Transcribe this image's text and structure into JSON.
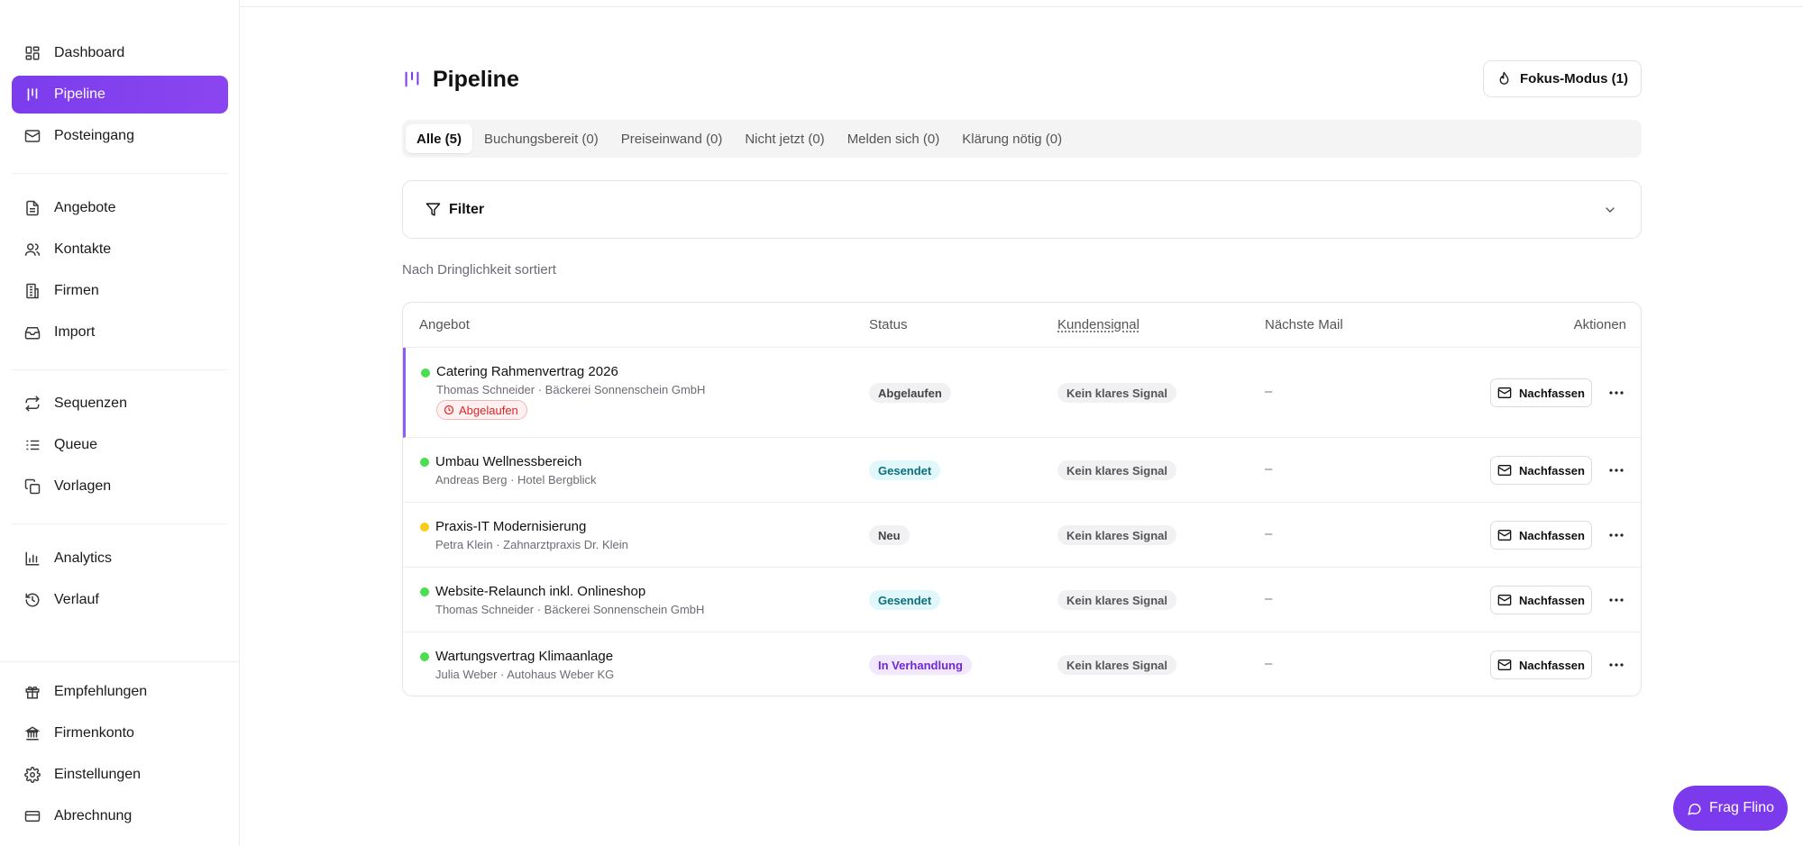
{
  "colors": {
    "accent": "#7c3aed",
    "status_green": "#4ade50",
    "status_yellow": "#facc15",
    "warning": "#dc2626"
  },
  "sidebar": {
    "groups": [
      [
        {
          "label": "Dashboard",
          "icon": "dashboard-icon"
        },
        {
          "label": "Pipeline",
          "icon": "pipeline-icon",
          "active": true
        },
        {
          "label": "Posteingang",
          "icon": "mail-icon"
        }
      ],
      [
        {
          "label": "Angebote",
          "icon": "document-icon"
        },
        {
          "label": "Kontakte",
          "icon": "users-icon"
        },
        {
          "label": "Firmen",
          "icon": "building-icon"
        },
        {
          "label": "Import",
          "icon": "inbox-icon"
        }
      ],
      [
        {
          "label": "Sequenzen",
          "icon": "repeat-icon"
        },
        {
          "label": "Queue",
          "icon": "list-icon"
        },
        {
          "label": "Vorlagen",
          "icon": "copy-icon"
        }
      ],
      [
        {
          "label": "Analytics",
          "icon": "chart-icon"
        },
        {
          "label": "Verlauf",
          "icon": "history-icon"
        }
      ],
      [
        {
          "label": "Empfehlungen",
          "icon": "gift-icon"
        },
        {
          "label": "Firmenkonto",
          "icon": "bank-icon"
        },
        {
          "label": "Einstellungen",
          "icon": "gear-icon"
        },
        {
          "label": "Abrechnung",
          "icon": "credit-card-icon"
        }
      ]
    ]
  },
  "header": {
    "title": "Pipeline",
    "fokus_label": "Fokus-Modus (1)"
  },
  "tabs": [
    {
      "label": "Alle (5)",
      "active": true
    },
    {
      "label": "Buchungsbereit (0)"
    },
    {
      "label": "Preiseinwand (0)"
    },
    {
      "label": "Nicht jetzt (0)"
    },
    {
      "label": "Melden sich (0)"
    },
    {
      "label": "Klärung nötig (0)"
    }
  ],
  "filter": {
    "label": "Filter"
  },
  "sort_note": "Nach Dringlichkeit sortiert",
  "table": {
    "columns": {
      "angebot": "Angebot",
      "status": "Status",
      "signal": "Kundensignal",
      "next_mail": "Nächste Mail",
      "actions": "Aktionen"
    },
    "action_label": "Nachfassen",
    "rows": [
      {
        "title": "Catering Rahmenvertrag 2026",
        "subtitle": "Thomas Schneider · Bäckerei Sonnenschein GmbH",
        "dot": "green",
        "warning": "Abgelaufen",
        "status": "Abgelaufen",
        "status_style": "gray",
        "signal": "Kein klares Signal",
        "next_mail": "–"
      },
      {
        "title": "Umbau Wellnessbereich",
        "subtitle": "Andreas Berg · Hotel Bergblick",
        "dot": "green",
        "status": "Gesendet",
        "status_style": "cyan",
        "signal": "Kein klares Signal",
        "next_mail": "–"
      },
      {
        "title": "Praxis-IT Modernisierung",
        "subtitle": "Petra Klein · Zahnarztpraxis Dr. Klein",
        "dot": "yellow",
        "status": "Neu",
        "status_style": "gray",
        "signal": "Kein klares Signal",
        "next_mail": "–"
      },
      {
        "title": "Website-Relaunch inkl. Onlineshop",
        "subtitle": "Thomas Schneider · Bäckerei Sonnenschein GmbH",
        "dot": "green",
        "status": "Gesendet",
        "status_style": "cyan",
        "signal": "Kein klares Signal",
        "next_mail": "–"
      },
      {
        "title": "Wartungsvertrag Klimaanlage",
        "subtitle": "Julia Weber · Autohaus Weber KG",
        "dot": "green",
        "status": "In Verhandlung",
        "status_style": "purple",
        "signal": "Kein klares Signal",
        "next_mail": "–"
      }
    ]
  },
  "assistant": {
    "label": "Frag Flino"
  }
}
